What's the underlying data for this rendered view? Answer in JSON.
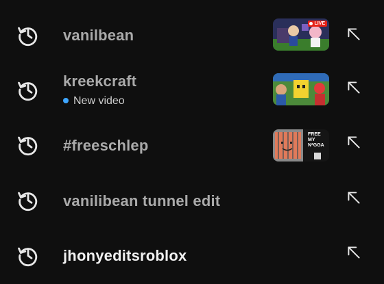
{
  "history": [
    {
      "query": "vanilbean",
      "thumbnail": "live-game-thumbnail",
      "badge": "LIVE",
      "subtitle": ""
    },
    {
      "query": "kreekcraft",
      "thumbnail": "game-thumbnail",
      "badge": "",
      "subtitle": "New video"
    },
    {
      "query": "#freeschlep",
      "thumbnail": "free-thumbnail",
      "badge": "",
      "subtitle": "",
      "thumb_text": [
        "FREE",
        "MY",
        "N*GGA"
      ]
    },
    {
      "query": "vanilibean tunnel edit",
      "thumbnail": "",
      "badge": "",
      "subtitle": ""
    },
    {
      "query": "jhonyeditsroblox",
      "thumbnail": "",
      "badge": "",
      "subtitle": ""
    }
  ],
  "icons": {
    "history": "history-icon",
    "fill_query": "arrow-up-left-icon"
  },
  "colors": {
    "background": "#0f0f0f",
    "text_dim": "#aaaaaa",
    "text_bright": "#f1f1f1",
    "new_dot": "#3ea6ff",
    "live_badge": "#e62117"
  }
}
